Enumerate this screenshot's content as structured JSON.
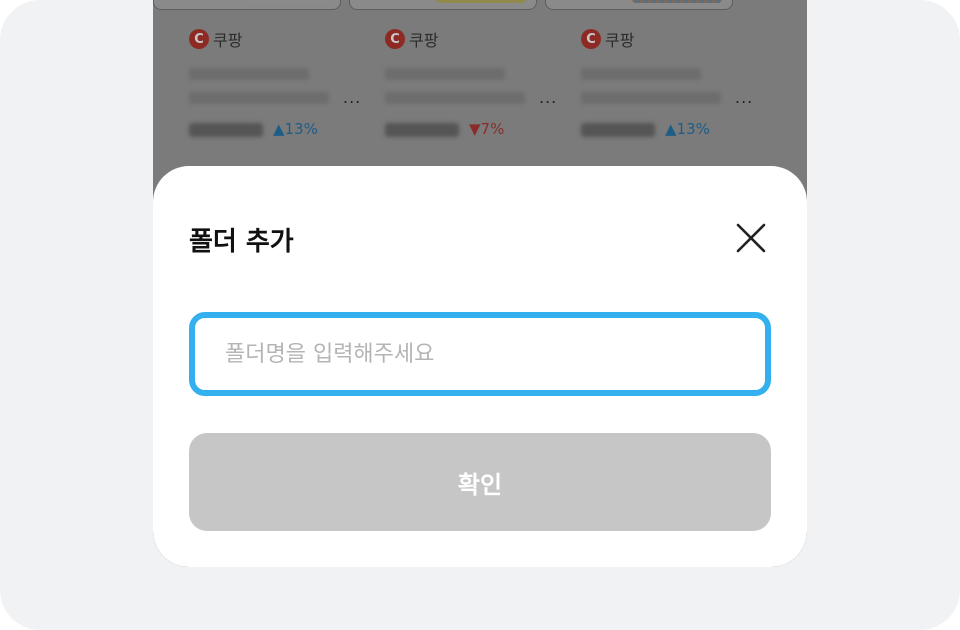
{
  "products": [
    {
      "store_logo": "C",
      "store_name": "쿠팡",
      "more": "...",
      "change": "▲13%",
      "direction": "up"
    },
    {
      "store_logo": "C",
      "store_name": "쿠팡",
      "more": "...",
      "change": "▼7%",
      "direction": "down"
    },
    {
      "store_logo": "C",
      "store_name": "쿠팡",
      "more": "...",
      "change": "▲13%",
      "direction": "up"
    }
  ],
  "modal": {
    "title": "폴더 추가",
    "close_icon": "close-icon",
    "input": {
      "placeholder": "폴더명을 입력해주세요",
      "value": ""
    },
    "confirm_label": "확인"
  },
  "colors": {
    "input_border": "#33b0ee",
    "confirm_disabled": "#c6c6c6",
    "up": "#1e5d86",
    "down": "#8a2c2c"
  }
}
